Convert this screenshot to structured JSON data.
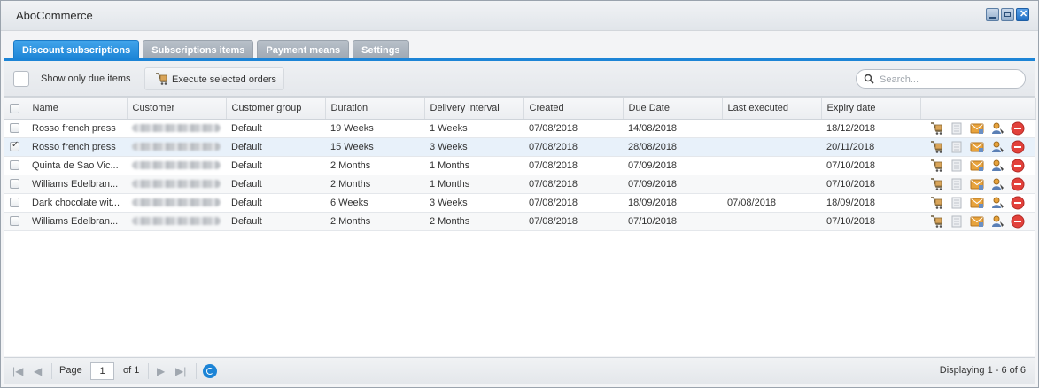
{
  "window": {
    "title": "AboCommerce"
  },
  "tabs": [
    {
      "label": "Discount subscriptions",
      "active": true
    },
    {
      "label": "Subscriptions items",
      "active": false
    },
    {
      "label": "Payment means",
      "active": false
    },
    {
      "label": "Settings",
      "active": false
    }
  ],
  "toolbar": {
    "due_items_label": "Show only due items",
    "execute_label": "Execute selected orders",
    "search_placeholder": "Search..."
  },
  "grid": {
    "columns": [
      "Name",
      "Customer",
      "Customer group",
      "Duration",
      "Delivery interval",
      "Created",
      "Due Date",
      "Last executed",
      "Expiry date"
    ],
    "rows": [
      {
        "checked": false,
        "name": "Rosso french press",
        "group": "Default",
        "duration": "19 Weeks",
        "interval": "1 Weeks",
        "created": "07/08/2018",
        "due": "14/08/2018",
        "last": "",
        "expiry": "18/12/2018"
      },
      {
        "checked": true,
        "name": "Rosso french press",
        "group": "Default",
        "duration": "15 Weeks",
        "interval": "3 Weeks",
        "created": "07/08/2018",
        "due": "28/08/2018",
        "last": "",
        "expiry": "20/11/2018"
      },
      {
        "checked": false,
        "name": "Quinta de Sao Vic...",
        "group": "Default",
        "duration": "2 Months",
        "interval": "1 Months",
        "created": "07/08/2018",
        "due": "07/09/2018",
        "last": "",
        "expiry": "07/10/2018"
      },
      {
        "checked": false,
        "name": "Williams Edelbran...",
        "group": "Default",
        "duration": "2 Months",
        "interval": "1 Months",
        "created": "07/08/2018",
        "due": "07/09/2018",
        "last": "",
        "expiry": "07/10/2018"
      },
      {
        "checked": false,
        "name": "Dark chocolate wit...",
        "group": "Default",
        "duration": "6 Weeks",
        "interval": "3 Weeks",
        "created": "07/08/2018",
        "due": "18/09/2018",
        "last": "07/08/2018",
        "expiry": "18/09/2018"
      },
      {
        "checked": false,
        "name": "Williams Edelbran...",
        "group": "Default",
        "duration": "2 Months",
        "interval": "2 Months",
        "created": "07/08/2018",
        "due": "07/10/2018",
        "last": "",
        "expiry": "07/10/2018"
      }
    ],
    "row_actions": [
      "execute-order-icon",
      "document-icon",
      "mail-icon",
      "customer-icon",
      "delete-icon"
    ]
  },
  "pager": {
    "page_label": "Page",
    "page_value": "1",
    "of_label": "of 1",
    "status": "Displaying 1 - 6 of 6"
  },
  "colors": {
    "accent": "#1c84d6",
    "delete": "#e2413b",
    "mail": "#e8a33c"
  }
}
